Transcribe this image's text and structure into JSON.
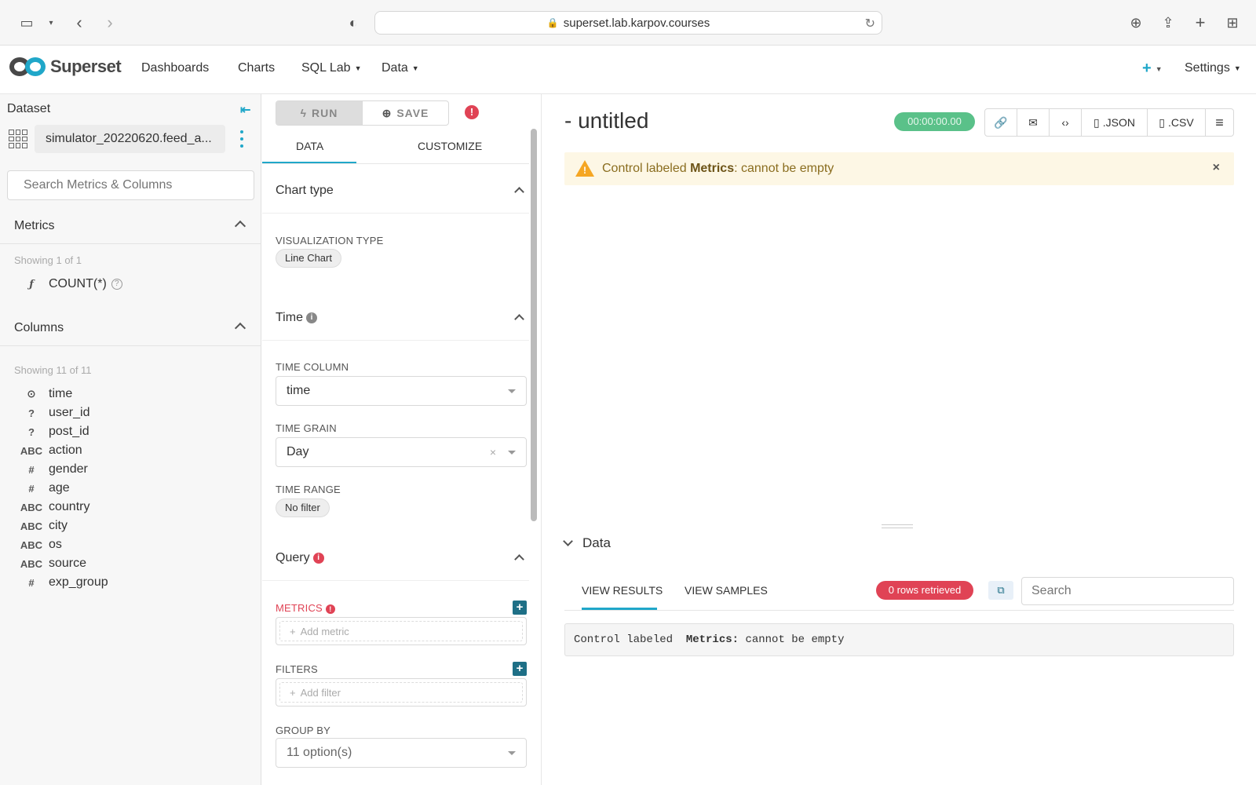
{
  "browser": {
    "url": "superset.lab.karpov.courses"
  },
  "nav": {
    "brand": "Superset",
    "items": [
      "Dashboards",
      "Charts",
      "SQL Lab",
      "Data"
    ],
    "settings": "Settings"
  },
  "dataset_panel": {
    "title": "Dataset",
    "dataset_name": "simulator_20220620.feed_a...",
    "search_placeholder": "Search Metrics & Columns",
    "metrics_header": "Metrics",
    "metrics_showing": "Showing 1 of 1",
    "metrics": [
      {
        "icon": "ƒ",
        "name": "COUNT(*)"
      }
    ],
    "columns_header": "Columns",
    "columns_showing": "Showing 11 of 11",
    "columns": [
      {
        "icon": "⊙",
        "name": "time"
      },
      {
        "icon": "?",
        "name": "user_id"
      },
      {
        "icon": "?",
        "name": "post_id"
      },
      {
        "icon": "ABC",
        "name": "action"
      },
      {
        "icon": "#",
        "name": "gender"
      },
      {
        "icon": "#",
        "name": "age"
      },
      {
        "icon": "ABC",
        "name": "country"
      },
      {
        "icon": "ABC",
        "name": "city"
      },
      {
        "icon": "ABC",
        "name": "os"
      },
      {
        "icon": "ABC",
        "name": "source"
      },
      {
        "icon": "#",
        "name": "exp_group"
      }
    ]
  },
  "control_panel": {
    "run_label": "RUN",
    "save_label": "SAVE",
    "tab_data": "DATA",
    "tab_customize": "CUSTOMIZE",
    "chart_type_header": "Chart type",
    "viz_type_label": "VISUALIZATION TYPE",
    "viz_type_value": "Line Chart",
    "time_header": "Time",
    "time_column_label": "TIME COLUMN",
    "time_column_value": "time",
    "time_grain_label": "TIME GRAIN",
    "time_grain_value": "Day",
    "time_range_label": "TIME RANGE",
    "time_range_value": "No filter",
    "query_header": "Query",
    "metrics_label": "METRICS",
    "add_metric": "Add metric",
    "filters_label": "FILTERS",
    "add_filter": "Add filter",
    "group_by_label": "GROUP BY",
    "group_by_placeholder": "11 option(s)"
  },
  "chart_panel": {
    "title": "- untitled",
    "timer": "00:00:00.00",
    "json_label": ".JSON",
    "csv_label": ".CSV",
    "alert_prefix": "Control labeled ",
    "alert_bold": "Metrics",
    "alert_suffix": ": cannot be empty",
    "data_header": "Data",
    "tab_results": "VIEW RESULTS",
    "tab_samples": "VIEW SAMPLES",
    "rows_badge": "0 rows retrieved",
    "search_placeholder": "Search",
    "code_prefix": "Control labeled  ",
    "code_bold": "Metrics:",
    "code_suffix": " cannot be empty"
  }
}
